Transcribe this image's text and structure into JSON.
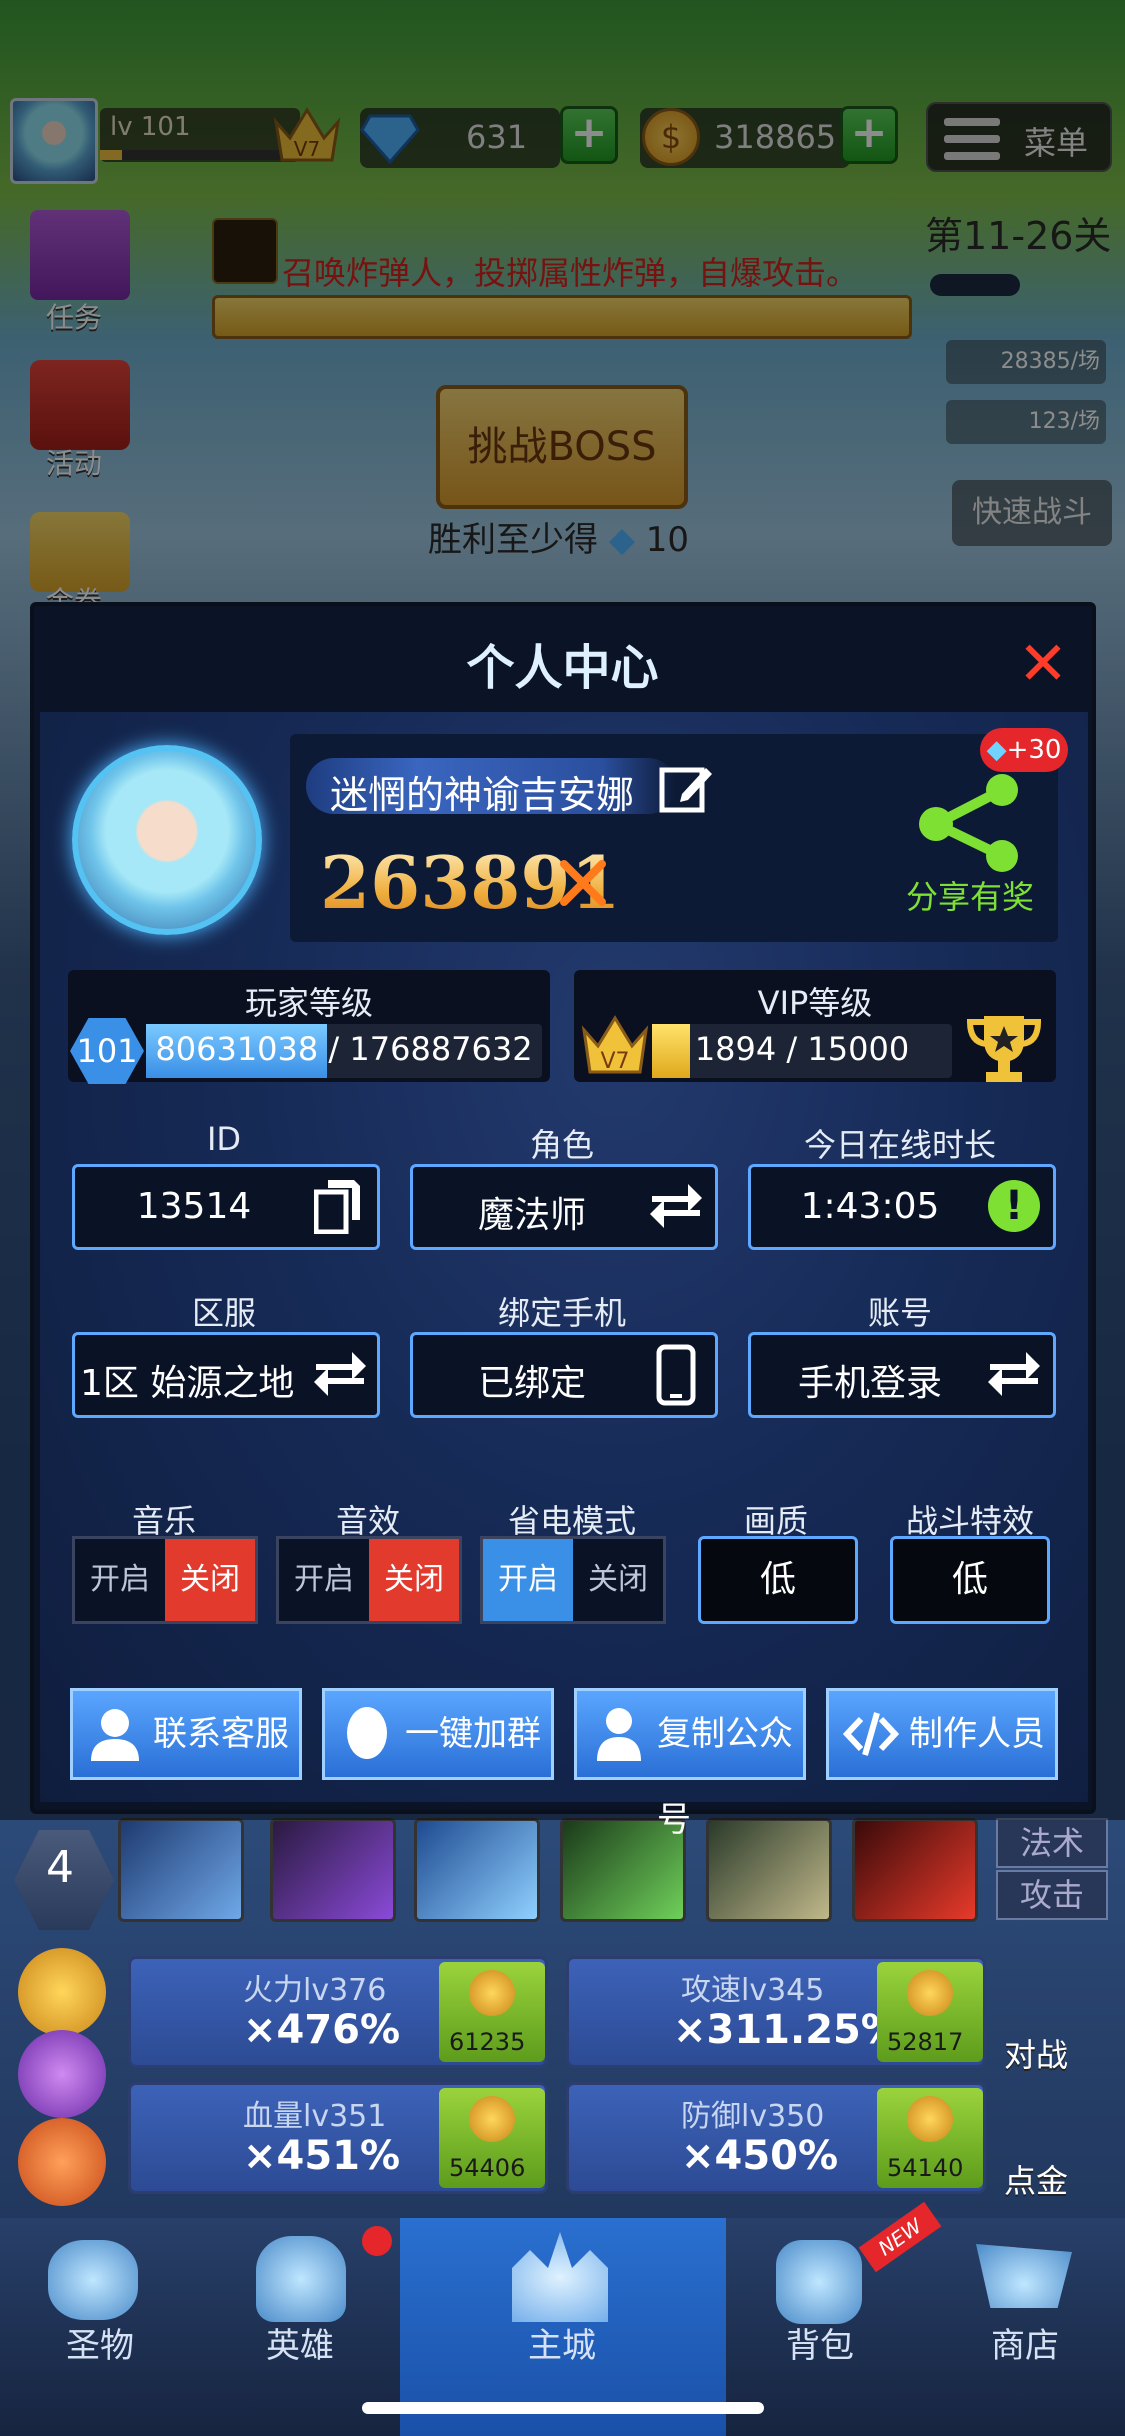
{
  "hud": {
    "level": "lv 101",
    "vip": "V7",
    "gems": "631",
    "gold": "318865",
    "menu_label": "菜单",
    "side": [
      "任务",
      "活动",
      "金券"
    ],
    "quest_text": "召唤炸弹人，投掷属性炸弹，自爆攻击。",
    "boss_button": "挑战BOSS",
    "win_reward": "胜利至少得",
    "win_reward_amount": "10",
    "stage": "第11-26关",
    "exp_rate": "28385/场",
    "gold_rate": "123/场",
    "fast_battle": "快速战斗"
  },
  "upgrades": [
    {
      "name": "火力lv376",
      "value": "×476%",
      "cost": "61235"
    },
    {
      "name": "攻速lv345",
      "value": "×311.25%",
      "cost": "52817"
    },
    {
      "name": "血量lv351",
      "value": "×451%",
      "cost": "54406"
    },
    {
      "name": "防御lv350",
      "value": "×450%",
      "cost": "54140"
    }
  ],
  "skills": {
    "count": "4",
    "right_top": "法术",
    "right_bottom": "攻击"
  },
  "side_right": {
    "battle": "对战",
    "gold": "点金"
  },
  "nav": [
    "圣物",
    "英雄",
    "主城",
    "背包",
    "商店"
  ],
  "nav_new_badge": "NEW",
  "modal": {
    "title": "个人中心",
    "player_name": "迷惘的神谕吉安娜",
    "power": "263891",
    "share_bonus": "+30",
    "share_label": "分享有奖",
    "player_level_title": "玩家等级",
    "player_level": "101",
    "player_exp": "80631038 / 176887632",
    "player_exp_fraction": 0.456,
    "vip_title": "VIP等级",
    "vip_level": "V7",
    "vip_exp": "1894 / 15000",
    "vip_exp_fraction": 0.126,
    "fields": [
      {
        "label": "ID",
        "value": "13514"
      },
      {
        "label": "角色",
        "value": "魔法师"
      },
      {
        "label": "今日在线时长",
        "value": "1:43:05"
      },
      {
        "label": "区服",
        "value": "1区 始源之地"
      },
      {
        "label": "绑定手机",
        "value": "已绑定"
      },
      {
        "label": "账号",
        "value": "手机登录"
      }
    ],
    "options": [
      {
        "label": "音乐",
        "on": "开启",
        "off": "关闭",
        "state": "off"
      },
      {
        "label": "音效",
        "on": "开启",
        "off": "关闭",
        "state": "off"
      },
      {
        "label": "省电模式",
        "on": "开启",
        "off": "关闭",
        "state": "on"
      }
    ],
    "quality_label": "画质",
    "quality_value": "低",
    "effects_label": "战斗特效",
    "effects_value": "低",
    "actions": [
      "联系客服",
      "一键加群",
      "复制公众号",
      "制作人员"
    ]
  },
  "colors": {
    "accent_blue": "#3a8fe6",
    "toggle_red": "#e23b2e",
    "share_green": "#7fe034"
  }
}
